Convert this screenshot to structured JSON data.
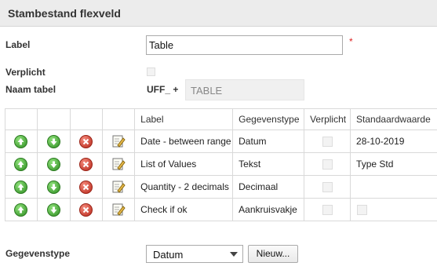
{
  "header": {
    "title": "Stambestand flexveld"
  },
  "form": {
    "label_label": "Label",
    "label_value": "Table",
    "required_mark": "*",
    "verplicht_label": "Verplicht",
    "naam_tabel_label": "Naam tabel",
    "prefix": "UFF_ +",
    "naam_tabel_value": "TABLE"
  },
  "table": {
    "headers": [
      "Label",
      "Gegevenstype",
      "Verplicht",
      "Standaardwaarde"
    ],
    "rows": [
      {
        "label": "Date - between range",
        "type": "Datum",
        "verplicht": false,
        "default": "28-10-2019",
        "default_is_checkbox": false
      },
      {
        "label": "List of Values",
        "type": "Tekst",
        "verplicht": false,
        "default": "Type Std",
        "default_is_checkbox": false
      },
      {
        "label": "Quantity - 2 decimals",
        "type": "Decimaal",
        "verplicht": false,
        "default": "",
        "default_is_checkbox": false
      },
      {
        "label": "Check if ok",
        "type": "Aankruisvakje",
        "verplicht": false,
        "default": "",
        "default_is_checkbox": true
      }
    ]
  },
  "footer": {
    "gegevenstype_label": "Gegevenstype",
    "selected_type": "Datum",
    "new_button": "Nieuw..."
  },
  "icons": {
    "move_up": "arrow-up-icon",
    "move_down": "arrow-down-icon",
    "delete": "delete-icon",
    "edit": "edit-icon",
    "dropdown": "chevron-down-icon"
  },
  "colors": {
    "header_bg": "#ececec",
    "green": "#2f8e22",
    "red": "#b7271a",
    "required": "#dd2222"
  }
}
